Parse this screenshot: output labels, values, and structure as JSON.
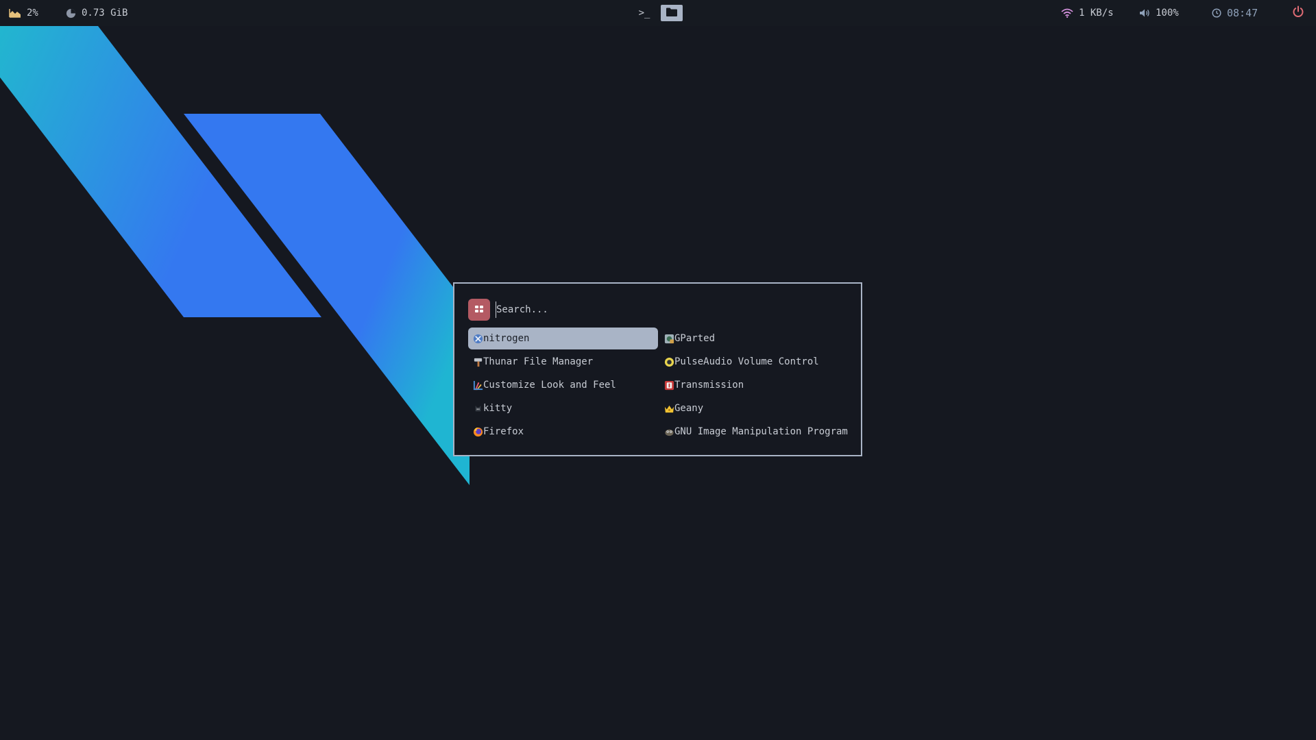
{
  "topbar": {
    "cpu": {
      "icon": "cpu-chart-icon",
      "value": "2%"
    },
    "memory": {
      "icon": "memory-pie-icon",
      "value": "0.73 GiB"
    },
    "workspaces": [
      {
        "name": "terminal",
        "icon": "terminal-icon",
        "label": ">_",
        "active": false
      },
      {
        "name": "files",
        "icon": "folder-icon",
        "active": true
      }
    ],
    "network": {
      "icon": "wifi-icon",
      "value": "1 KB/s"
    },
    "volume": {
      "icon": "volume-icon",
      "value": "100%"
    },
    "clock": {
      "icon": "clock-icon",
      "value": "08:47"
    },
    "power": {
      "icon": "power-icon",
      "color": "#e06c75"
    }
  },
  "launcher": {
    "mode_icon": "grid-icon",
    "mode_color": "#b45a63",
    "search": {
      "placeholder": "Search...",
      "value": ""
    },
    "apps": [
      {
        "label": "nitrogen",
        "icon": "nitrogen-icon",
        "selected": true
      },
      {
        "label": "GParted",
        "icon": "gparted-icon",
        "selected": false
      },
      {
        "label": "Thunar File Manager",
        "icon": "thunar-icon",
        "selected": false
      },
      {
        "label": "PulseAudio Volume Control",
        "icon": "pulseaudio-icon",
        "selected": false
      },
      {
        "label": "Customize Look and Feel",
        "icon": "appearance-icon",
        "selected": false
      },
      {
        "label": "Transmission",
        "icon": "transmission-icon",
        "selected": false
      },
      {
        "label": "kitty",
        "icon": "kitty-icon",
        "selected": false
      },
      {
        "label": "Geany",
        "icon": "geany-icon",
        "selected": false
      },
      {
        "label": "Firefox",
        "icon": "firefox-icon",
        "selected": false
      },
      {
        "label": "GNU Image Manipulation Program",
        "icon": "gimp-icon",
        "selected": false
      }
    ]
  },
  "colors": {
    "background": "#151820",
    "accent": "#a9b4c6",
    "wallpaper_cyan": "#22b6cf",
    "wallpaper_blue": "#3478f0"
  }
}
